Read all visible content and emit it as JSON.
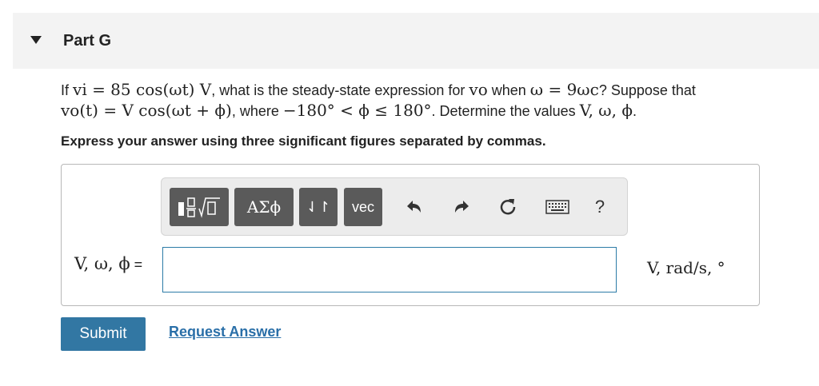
{
  "part": {
    "title": "Part G"
  },
  "question": {
    "p1": "If ",
    "m_vi": "vi = 85 cos(ωt) V",
    "p2": ", what is the steady-state expression for ",
    "m_vo": "vo",
    "p3": " when ",
    "m_w": "ω = 9ωc",
    "p4": "? Suppose that",
    "m_vot": "vo(t) = V cos(ωt + ϕ)",
    "p5": ", where ",
    "m_range": "−180° < ϕ ≤ 180°",
    "p6": ". Determine the values ",
    "m_vals": "V, ω, ϕ",
    "p7": "."
  },
  "instruction": "Express your answer using three significant figures separated by commas.",
  "toolbar": {
    "greek_label": "ΑΣϕ",
    "arrows_label": "⇃↾",
    "vec_label": "vec",
    "help_label": "?"
  },
  "answer": {
    "variable_label": "V, ω, ϕ",
    "equals": " =",
    "value": "",
    "units": "V, rad/s, °"
  },
  "buttons": {
    "submit": "Submit",
    "request_answer": "Request Answer"
  }
}
